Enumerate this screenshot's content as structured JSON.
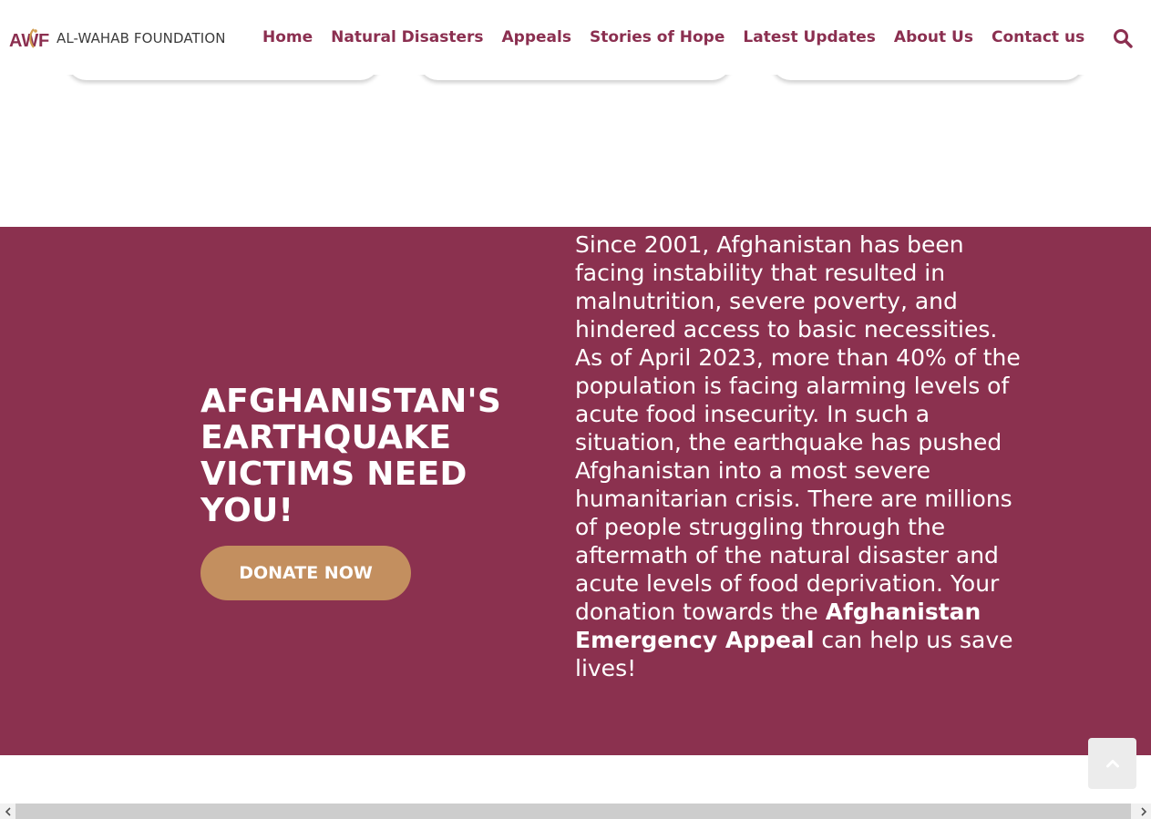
{
  "header": {
    "logo_text": "AL-WAHAB FOUNDATION",
    "nav": [
      "Home",
      "Natural Disasters",
      "Appeals",
      "Stories of Hope",
      "Latest Updates",
      "About Us",
      "Contact us"
    ],
    "search_icon": "search-icon"
  },
  "appeal": {
    "title": "AFGHANISTAN'S EARTHQUAKE VICTIMS NEED YOU!",
    "donate_label": "DONATE NOW",
    "body_text": "Since 2001, Afghanistan has been facing instability that resulted in malnutrition, severe poverty, and hindered access to basic necessities. As of April 2023, more than 40% of the population is facing alarming levels of acute food insecurity. In such a situation, the earthquake has pushed Afghanistan into a most severe humanitarian crisis. There are millions of people struggling through the aftermath of the natural disaster and acute levels of food deprivation. Your donation towards the ",
    "body_bold": "Afghanistan Emergency Appeal",
    "body_end": " can help us save lives!"
  },
  "colors": {
    "brand": "#8b2f50",
    "section_bg": "#8b314f",
    "donate_bg": "#c38f5f",
    "logo_gold": "#d19b4c"
  },
  "icons": {
    "scroll_top": "chevron-up-icon",
    "scroll_left": "chevron-left-icon",
    "scroll_right": "chevron-right-icon"
  }
}
